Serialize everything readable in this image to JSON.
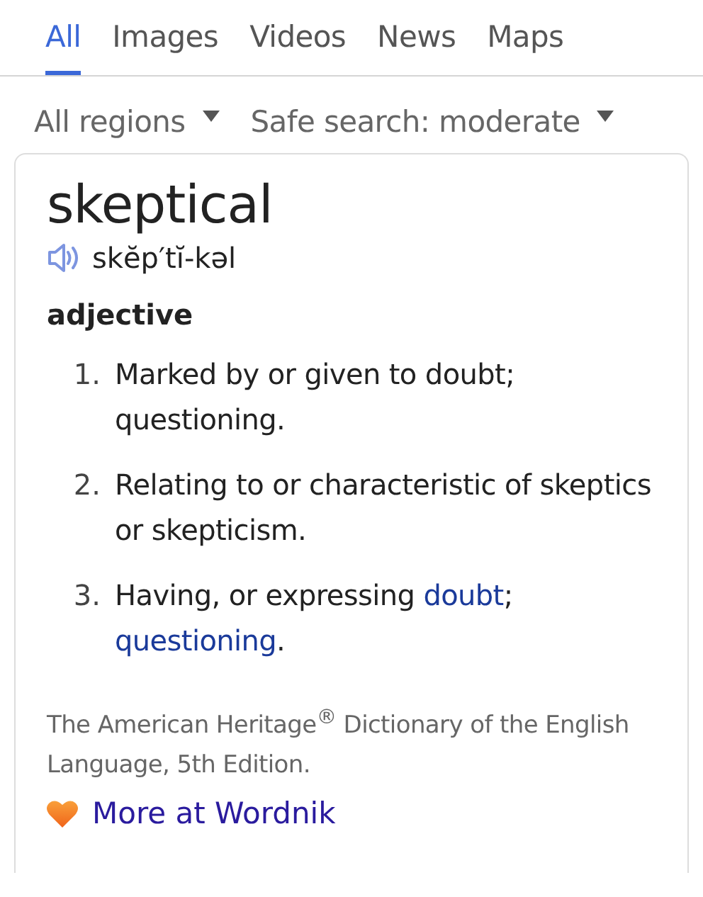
{
  "tabs": [
    {
      "label": "All",
      "selected": true
    },
    {
      "label": "Images",
      "selected": false
    },
    {
      "label": "Videos",
      "selected": false
    },
    {
      "label": "News",
      "selected": false
    },
    {
      "label": "Maps",
      "selected": false
    }
  ],
  "filters": [
    {
      "label": "All regions"
    },
    {
      "label": "Safe search: moderate"
    }
  ],
  "definition": {
    "word": "skeptical",
    "pronunciation": "skĕp′tĭ-kəl",
    "part_of_speech": "adjective",
    "senses": [
      {
        "number": "1.",
        "parts": [
          {
            "kind": "text",
            "text": "Marked by or given to doubt; questioning."
          }
        ]
      },
      {
        "number": "2.",
        "parts": [
          {
            "kind": "text",
            "text": "Relating to or characteristic of skeptics or skepticism."
          }
        ]
      },
      {
        "number": "3.",
        "parts": [
          {
            "kind": "text",
            "text": "Having, or expressing "
          },
          {
            "kind": "link",
            "text": "doubt"
          },
          {
            "kind": "text",
            "text": "; "
          },
          {
            "kind": "link",
            "text": "questioning"
          },
          {
            "kind": "text",
            "text": "."
          }
        ]
      }
    ],
    "source": "The American Heritage$^{®}$ Dictionary of the English Language, 5th Edition.",
    "more_link": "More at Wordnik"
  }
}
